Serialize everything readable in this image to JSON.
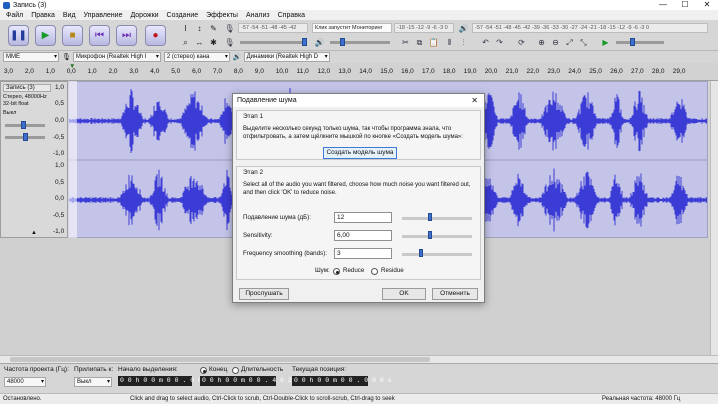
{
  "window": {
    "title": "Запись (3)",
    "minimize": "—",
    "maximize": "☐",
    "close": "✕"
  },
  "menu": [
    "Файл",
    "Правка",
    "Вид",
    "Управление",
    "Дорожки",
    "Создание",
    "Эффекты",
    "Анализ",
    "Справка"
  ],
  "meters": {
    "record_scale": "-57 -54 -51 -48 -45 -42",
    "record_prompt": "Клик запустит Мониторинг",
    "record_tail": "-18 -15 -12 -9 -6 -3 0",
    "play_scale": "-57 -54 -51 -48 -45 -42 -39 -36 -33 -30 -27 -24 -21 -18 -15 -12 -9 -6 -3 0"
  },
  "devices": {
    "host": "MME",
    "mic": "Микрофон (Realtek High I",
    "channels": "2 (стерео) кана",
    "speakers": "Динамики (Realtek High D"
  },
  "ruler": [
    "3,0",
    "2,0",
    "1,0",
    "0,0",
    "1,0",
    "2,0",
    "3,0",
    "4,0",
    "5,0",
    "6,0",
    "7,0",
    "8,0",
    "9,0",
    "10,0",
    "11,0",
    "12,0",
    "13,0",
    "14,0",
    "15,0",
    "16,0",
    "17,0",
    "18,0",
    "19,0",
    "20,0",
    "21,0",
    "22,0",
    "23,0",
    "24,0",
    "25,0",
    "26,0",
    "27,0",
    "28,0",
    "29,0"
  ],
  "track": {
    "name": "Запись (3)",
    "info1": "Стерео, 48000Hz",
    "info2": "32-bit float",
    "mute": "Выкл",
    "solo": "Соло",
    "scale_top": [
      "1,0",
      "0,5",
      "0,0",
      "-0,5",
      "-1,0"
    ],
    "scale_bottom": [
      "1,0",
      "0,5",
      "0,0",
      "-0,5",
      "-1,0"
    ]
  },
  "dialog": {
    "title": "Подавление шума",
    "stage1": {
      "title": "Этап 1",
      "text": "Выделите несколько секунд только шума, так чтобы программа знала, что отфильтровать, а затем щёлкните мышкой по кнопке «Создать модель шума»:",
      "button": "Создать модель шума"
    },
    "stage2": {
      "title": "Этап 2",
      "text": "Select all of the audio you want filtered, choose how much noise you want filtered out, and then click 'OK' to reduce noise.",
      "noise_label": "Подавление шума (дБ):",
      "noise_value": "12",
      "noise_level": 0.4,
      "sens_label": "Sensitivity:",
      "sens_value": "6,00",
      "sens_level": 0.4,
      "smooth_label": "Frequency smoothing (bands):",
      "smooth_value": "3",
      "smooth_level": 0.25,
      "mode_label": "Шум:",
      "mode_reduce": "Reduce",
      "mode_residue": "Residue"
    },
    "preview": "Прослушать",
    "ok": "OK",
    "cancel": "Отменить"
  },
  "selection_bar": {
    "rate_label": "Частота проекта (Гц):",
    "rate_value": "48000",
    "snap_label": "Прилипать к:",
    "snap_value": "Выкл",
    "start_label": "Начало выделения:",
    "start_value": "0 0 h 0 0 m 0 0 . 0 0 0 s",
    "end_label": "Конец",
    "length_label": "Длительность",
    "end_value": "0 0 h 0 0 m 0 0 . 4 6 2 s",
    "pos_label": "Текущая позиция:",
    "pos_value": "0 0 h 0 0 m 0 0 . 0 0 0 s"
  },
  "status": {
    "left": "Остановлено.",
    "hint": "Click and drag to select audio, Ctrl-Click to scrub, Ctrl-Double-Click to scroll-scrub, Ctrl-drag to seek",
    "right": "Реальная частота: 48000 Гц"
  },
  "colors": {
    "wave": "#3b3bd6",
    "wave_bg": "#c4c4e8",
    "accent": "#3d6fd1"
  }
}
